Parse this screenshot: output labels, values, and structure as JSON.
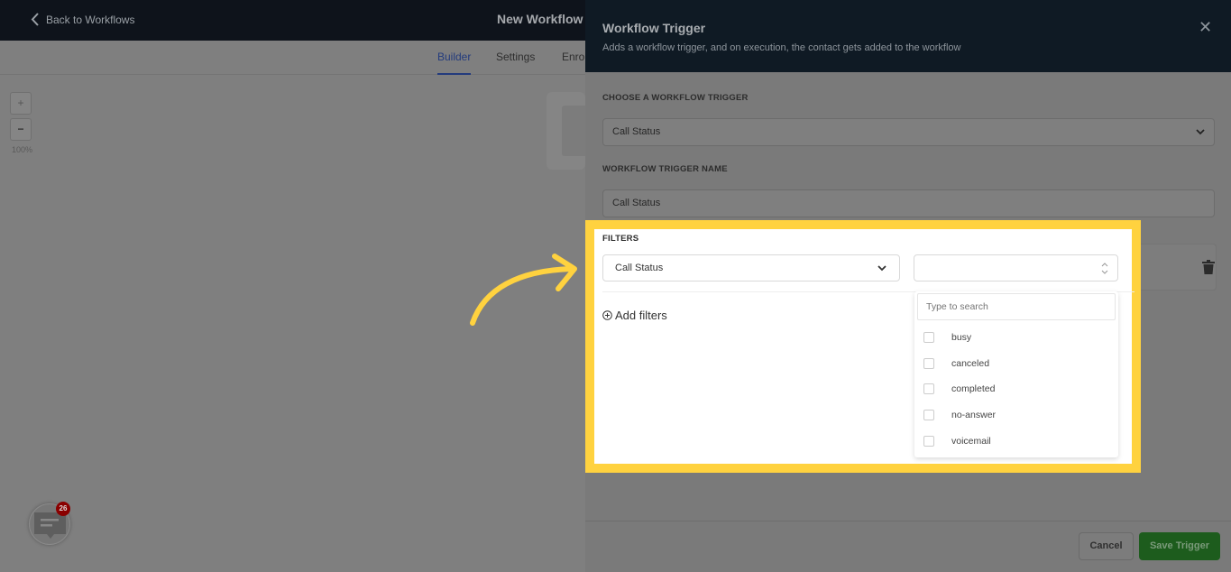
{
  "header": {
    "back_label": "Back to Workflows",
    "title": "New Workflow"
  },
  "tabs": [
    {
      "label": "Builder",
      "active": true
    },
    {
      "label": "Settings"
    },
    {
      "label": "Enro"
    }
  ],
  "zoom": {
    "in": "+",
    "out": "−",
    "level": "100%"
  },
  "panel": {
    "title": "Workflow Trigger",
    "subtitle": "Adds a workflow trigger, and on execution, the contact gets added to the workflow",
    "choose_label": "CHOOSE A WORKFLOW TRIGGER",
    "trigger_value": "Call Status",
    "name_label": "WORKFLOW TRIGGER NAME",
    "name_value": "Call Status",
    "filters": {
      "label": "FILTERS",
      "field": "Call Status",
      "value": "",
      "add_label": "Add filters",
      "search_placeholder": "Type to search",
      "options": [
        "busy",
        "canceled",
        "completed",
        "no-answer",
        "voicemail"
      ]
    },
    "cancel": "Cancel",
    "save": "Save Trigger"
  },
  "chat": {
    "badge": "26"
  },
  "colors": {
    "highlight": "#ffd23f",
    "save": "#1d5c1d",
    "active_tab": "#233b7d"
  }
}
